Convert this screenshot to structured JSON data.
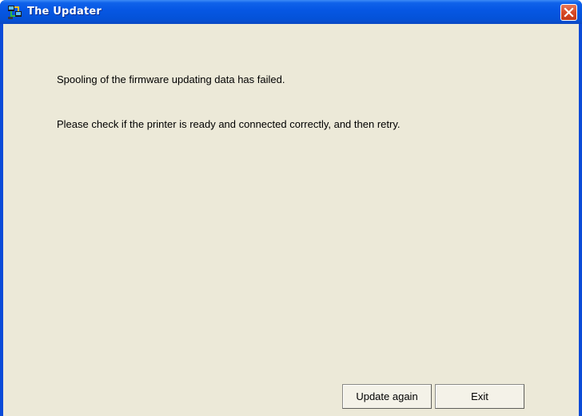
{
  "window": {
    "title": "The Updater",
    "close_icon": "close-icon",
    "app_icon": "updater-app-icon"
  },
  "dialog": {
    "message_line1": "Spooling of the firmware updating data has failed.",
    "message_line2": "Please check if the printer is ready and connected correctly, and then retry."
  },
  "buttons": {
    "update_again_label": "Update again",
    "exit_label": "Exit"
  },
  "colors": {
    "titlebar": "#0657e4",
    "client_background": "#ece9d8",
    "close_button": "#d84a26"
  }
}
